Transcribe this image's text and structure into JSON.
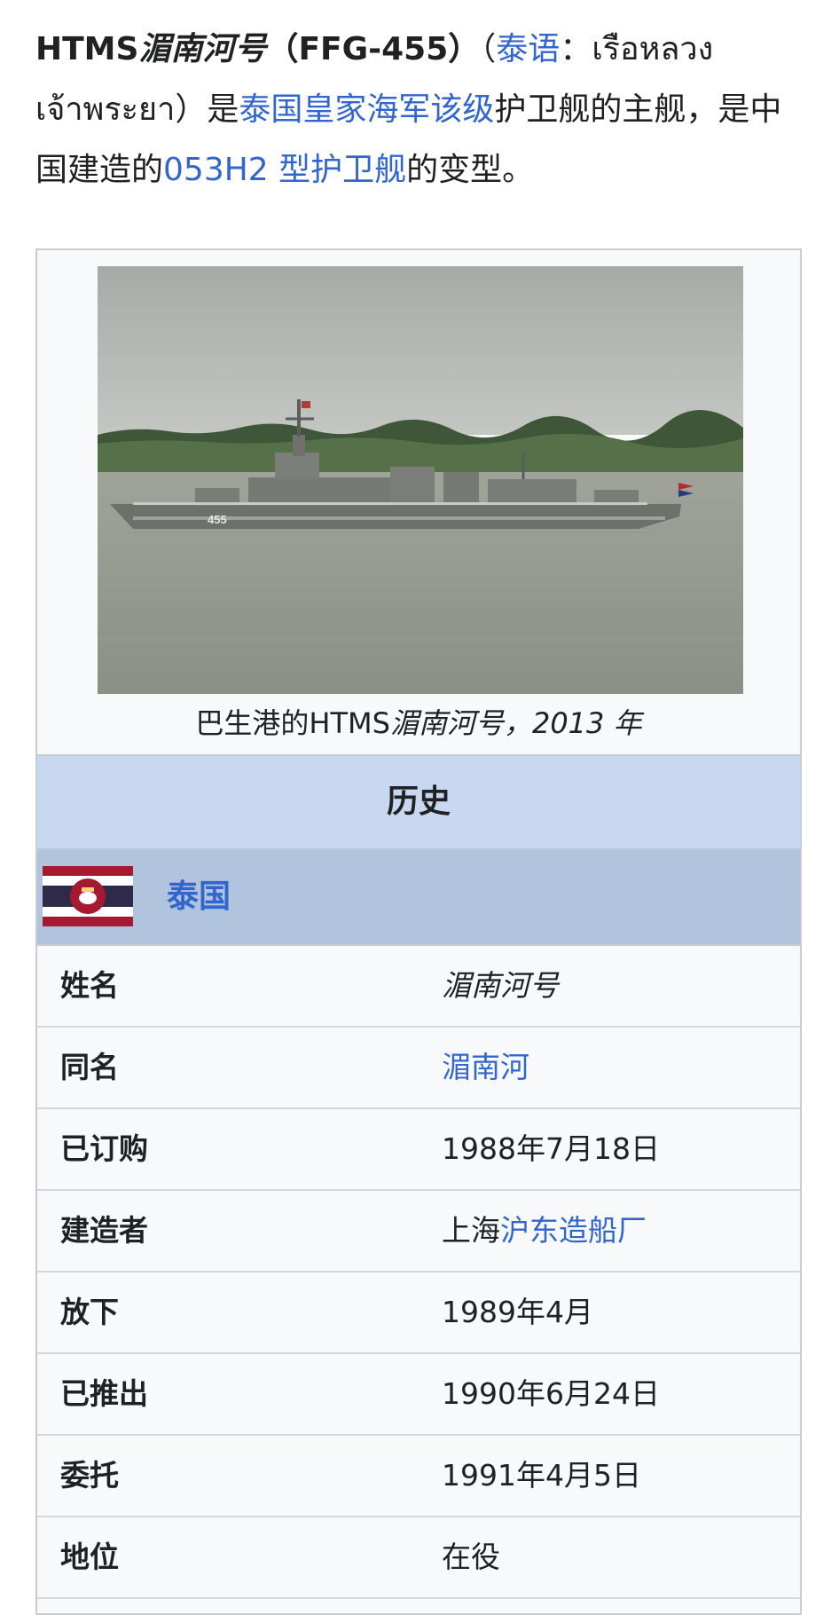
{
  "intro": {
    "title_prefix": "HTMS",
    "title_name": "湄南河号",
    "hull_code": "（FFG-455）",
    "open_paren": "（",
    "thai_link": "泰语",
    "colon": "：",
    "thai_text": "เรือหลวงเจ้าพระยา",
    "close_paren": "）",
    "is": "是",
    "navy_link": "泰国皇家海军该级",
    "text2": "护卫舰的主舰，是中国建造的",
    "type_link": "053H2 型护卫舰",
    "text3": "的变型。"
  },
  "infobox": {
    "hull_number": "455",
    "caption_prefix": "巴生港的HTMS",
    "caption_italic": "湄南河号，2013 年",
    "history_header": "历史",
    "country": "泰国",
    "rows": [
      {
        "label": "姓名",
        "value": "湄南河号"
      },
      {
        "label": "同名",
        "value": "湄南河"
      },
      {
        "label": "已订购",
        "value": "1988年7月18日"
      },
      {
        "label": "建造者",
        "value_plain": "上海",
        "value_link": "沪东造船厂"
      },
      {
        "label": "放下",
        "value": "1989年4月"
      },
      {
        "label": "已推出",
        "value": "1990年6月24日"
      },
      {
        "label": "委托",
        "value": "1991年4月5日"
      },
      {
        "label": "地位",
        "value": "在役"
      }
    ]
  }
}
